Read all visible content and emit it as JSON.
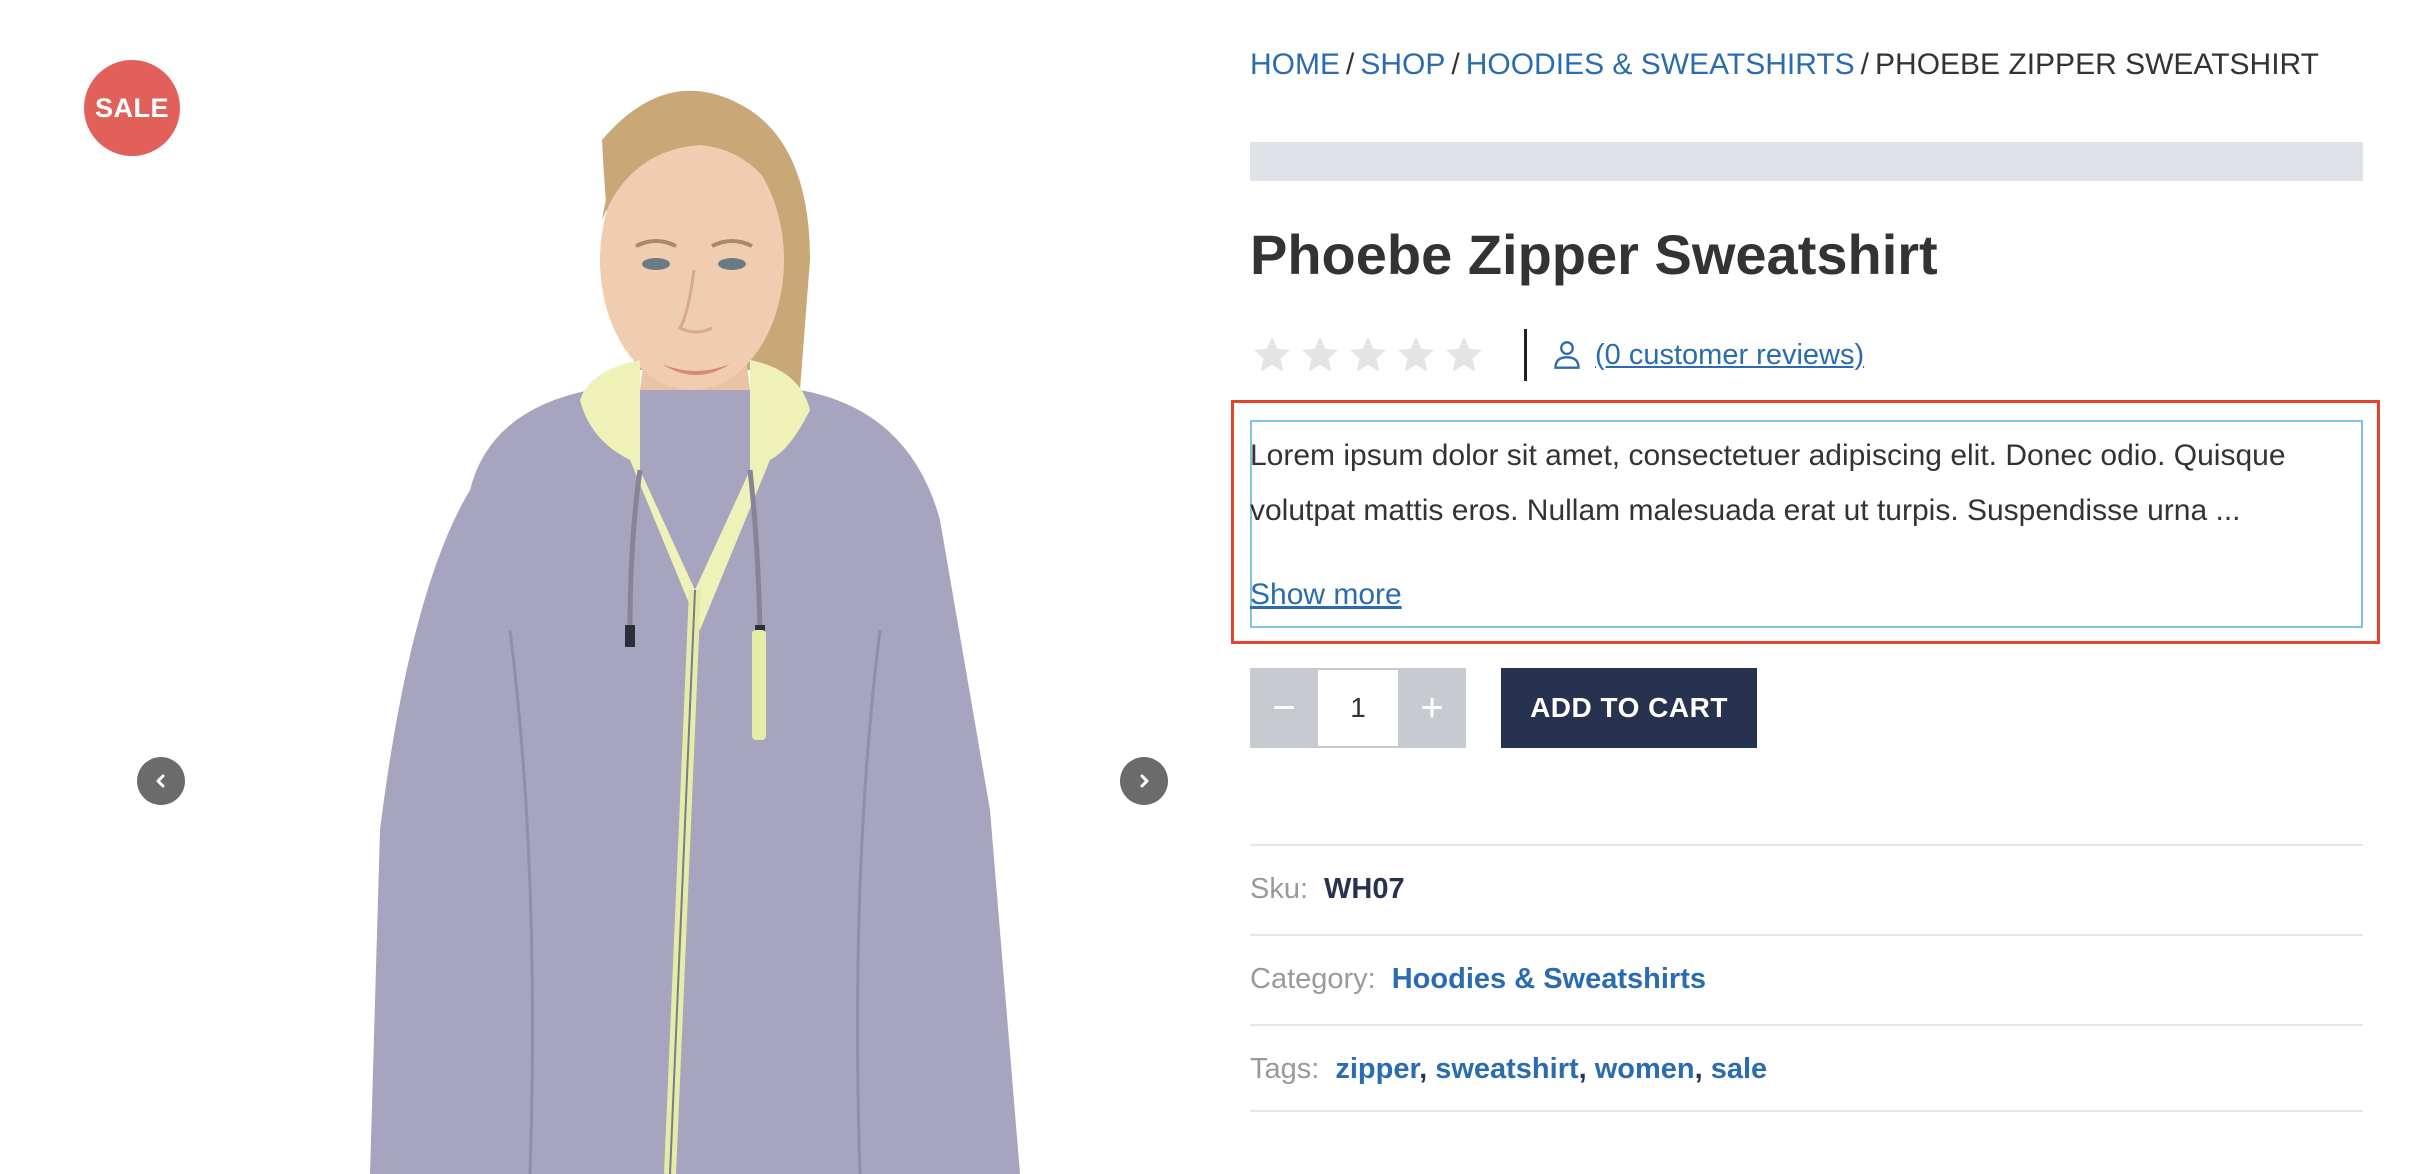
{
  "gallery": {
    "sale_badge": "SALE",
    "prev_icon": "chevron-left-icon",
    "next_icon": "chevron-right-icon"
  },
  "breadcrumb": {
    "items": [
      "HOME",
      "SHOP",
      "HOODIES & SWEATSHIRTS"
    ],
    "current": "PHOEBE ZIPPER SWEATSHIRT",
    "separator": "/"
  },
  "product": {
    "title": "Phoebe Zipper Sweatshirt",
    "rating": {
      "stars_filled": 0,
      "stars_total": 5
    },
    "reviews_link": "(0 customer reviews)",
    "description": "Lorem ipsum dolor sit amet, consectetuer adipiscing elit. Donec odio. Quisque volutpat mattis eros. Nullam malesuada erat ut turpis. Suspendisse urna ...",
    "show_more": "Show more",
    "quantity": "1",
    "qty_minus": "−",
    "qty_plus": "+",
    "add_to_cart": "ADD TO CART"
  },
  "meta": {
    "sku_label": "Sku:",
    "sku_value": "WH07",
    "category_label": "Category:",
    "category_value": "Hoodies & Sweatshirts",
    "tags_label": "Tags:",
    "tags": [
      "zipper",
      "sweatshirt",
      "women",
      "sale"
    ]
  },
  "colors": {
    "link": "#2b6cb0",
    "sale_badge": "#e2605a",
    "primary_button": "#273250",
    "highlight_border": "#e2452c"
  }
}
